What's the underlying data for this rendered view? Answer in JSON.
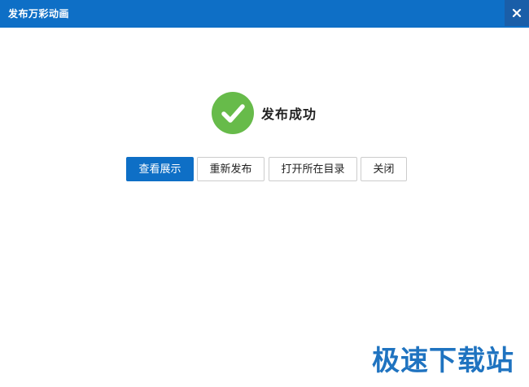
{
  "window": {
    "title": "发布万彩动画",
    "close_label": "×",
    "close_icon": "close-icon",
    "accent_color": "#0e6fc6"
  },
  "status": {
    "message": "发布成功",
    "icon": "check-circle-icon",
    "icon_color": "#67bb4a"
  },
  "actions": {
    "view": "查看展示",
    "republish": "重新发布",
    "open_folder": "打开所在目录",
    "close": "关闭"
  },
  "watermark": {
    "text": "极速下载站"
  }
}
